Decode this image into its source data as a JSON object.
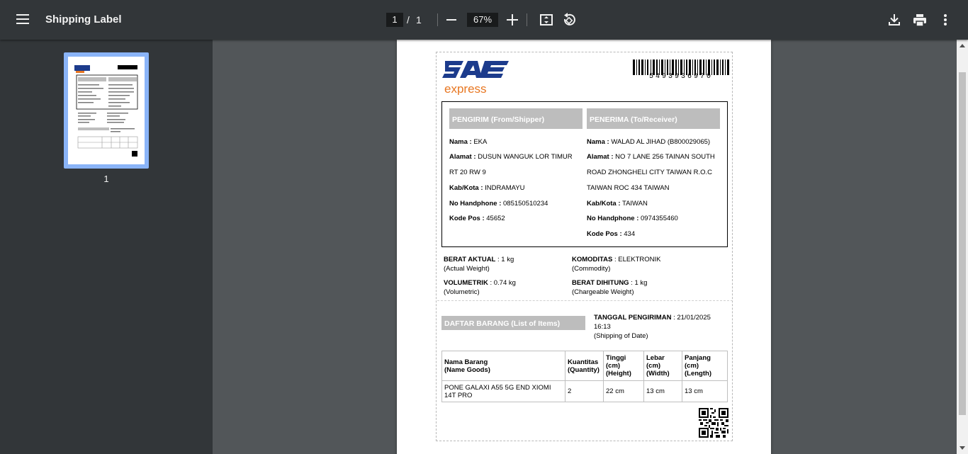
{
  "toolbar": {
    "title": "Shipping Label",
    "page_current": "1",
    "page_sep": "/",
    "page_total": "1",
    "zoom": "67%"
  },
  "sidebar": {
    "thumbnail_label": "1"
  },
  "label": {
    "logo_text": "express",
    "tracking_number": "5493936970",
    "shipper": {
      "header": "PENGIRIM (From/Shipper)",
      "name_label": "Nama :",
      "name": "EKA",
      "address_label": "Alamat :",
      "address_line1": "DUSUN WANGUK LOR TIMUR",
      "address_line2": "RT 20 RW 9",
      "city_label": "Kab/Kota :",
      "city": "INDRAMAYU",
      "phone_label": "No Handphone :",
      "phone": "085150510234",
      "postal_label": "Kode Pos :",
      "postal": "45652"
    },
    "receiver": {
      "header": "PENERIMA (To/Receiver)",
      "name_label": "Nama :",
      "name": "WALAD AL JIHAD (B800029065)",
      "address_label": "Alamat :",
      "address_line1": "NO 7 LANE 256 TAINAN SOUTH",
      "address_line2": "ROAD ZHONGHELI CITY TAIWAN R.O.C",
      "address_line3": "TAIWAN ROC 434 TAIWAN",
      "city_label": "Kab/Kota :",
      "city": "TAIWAN",
      "phone_label": "No Handphone :",
      "phone": "0974355460",
      "postal_label": "Kode Pos :",
      "postal": "434"
    },
    "weights": {
      "actual_label": "BERAT AKTUAL",
      "actual_value": ": 1 kg",
      "actual_sub": "(Actual Weight)",
      "commodity_label": "KOMODITAS",
      "commodity_value": ": ELEKTRONIK",
      "commodity_sub": "(Commodity)",
      "volumetric_label": "VOLUMETRIK",
      "volumetric_value": ": 0.74 kg",
      "volumetric_sub": "(Volumetric)",
      "chargeable_label": "BERAT DIHITUNG",
      "chargeable_value": ": 1 kg",
      "chargeable_sub": "(Chargeable Weight)"
    },
    "items_header": "DAFTAR BARANG (List of Items)",
    "shipping_date_label": "TANGGAL PENGIRIMAN",
    "shipping_date_value": ": 21/01/2025",
    "shipping_time": "16:13",
    "shipping_date_sub": "(Shipping of Date)",
    "table": {
      "headers": [
        [
          "Nama Barang",
          "(Name Goods)"
        ],
        [
          "Kuantitas",
          "(Quantity)"
        ],
        [
          "Tinggi",
          "(cm)",
          "(Height)"
        ],
        [
          "Lebar",
          "(cm)",
          "(Width)"
        ],
        [
          "Panjang",
          "(cm)",
          "(Length)"
        ]
      ],
      "rows": [
        [
          "PONE GALAXI A55 5G END XIOMI 14T PRO",
          "2",
          "22 cm",
          "13 cm",
          "13 cm"
        ]
      ]
    }
  }
}
